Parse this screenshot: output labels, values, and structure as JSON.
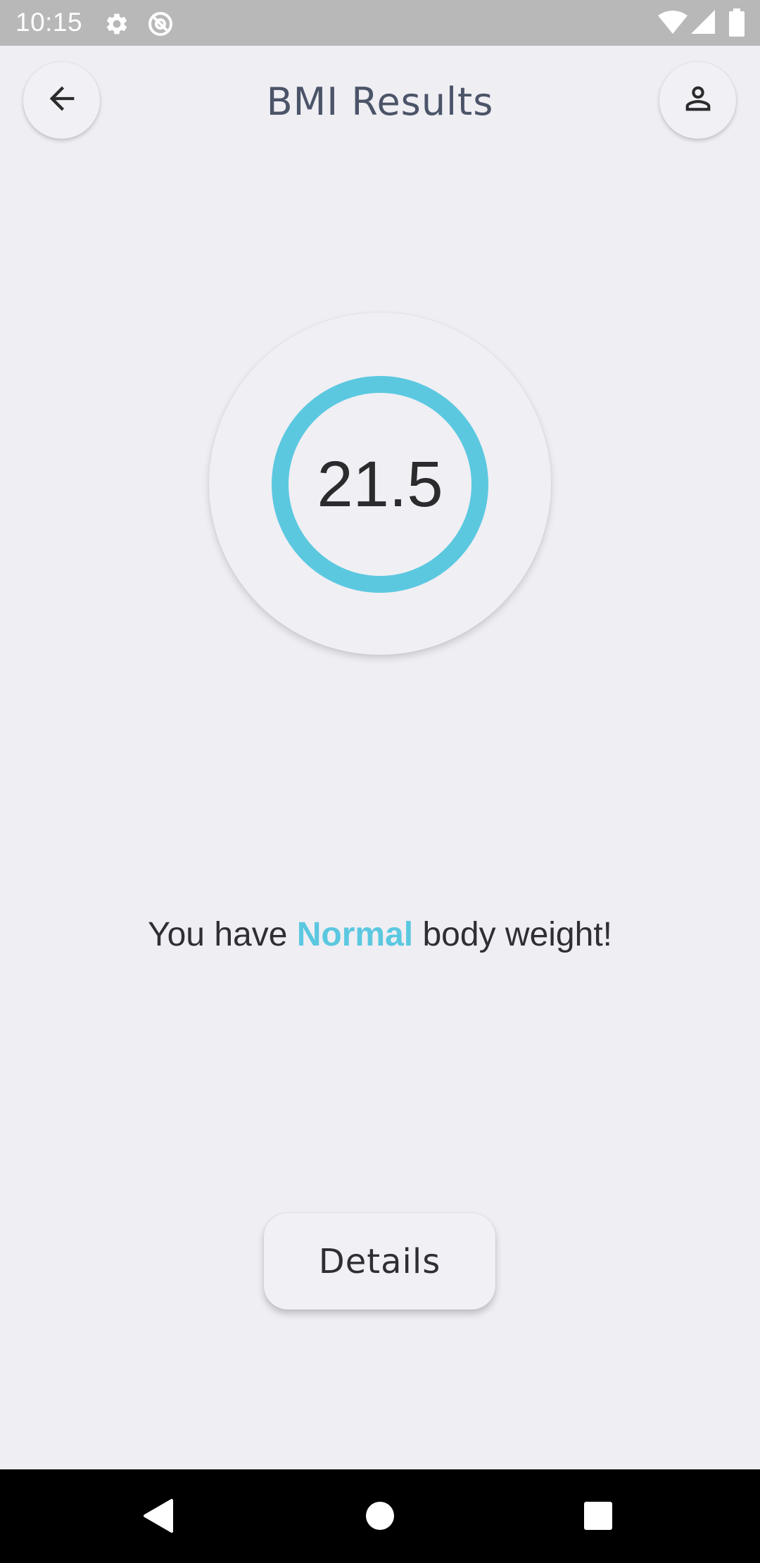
{
  "status_bar": {
    "time": "10:15",
    "left_icons": [
      "gear-icon",
      "at-sign-icon"
    ],
    "right_icons": [
      "wifi-icon",
      "cellular-signal-icon",
      "battery-icon"
    ],
    "background": "#b8b8b8"
  },
  "header": {
    "title": "BMI Results",
    "back_icon": "arrow-left-icon",
    "profile_icon": "person-icon"
  },
  "result": {
    "bmi_value": "21.5",
    "ring_color": "#5bc8e0"
  },
  "message": {
    "prefix": "You have ",
    "category": "Normal",
    "suffix": " body weight!",
    "category_color": "#5bc8e0"
  },
  "actions": {
    "details_label": "Details"
  },
  "nav_bar": {
    "back_icon": "triangle-back-icon",
    "home_icon": "circle-home-icon",
    "recents_icon": "square-recents-icon"
  }
}
